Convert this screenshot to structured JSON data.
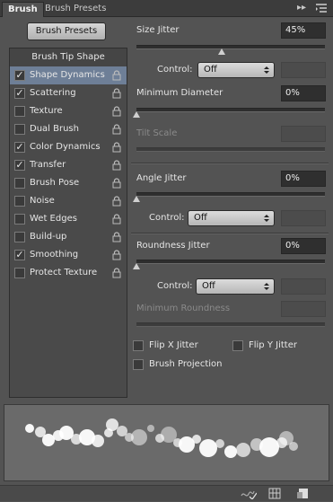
{
  "tabs": [
    {
      "label": "Brush",
      "active": true
    },
    {
      "label": "Brush Presets",
      "active": false
    }
  ],
  "panel_menu_icons": [
    "double-arrow-icon",
    "panel-menu-icon"
  ],
  "brush_presets_button": "Brush Presets",
  "left_list": {
    "header": "Brush Tip Shape",
    "items": [
      {
        "label": "Shape Dynamics",
        "checked": true,
        "selected": true,
        "locked": true
      },
      {
        "label": "Scattering",
        "checked": true,
        "selected": false,
        "locked": true
      },
      {
        "label": "Texture",
        "checked": false,
        "selected": false,
        "locked": true
      },
      {
        "label": "Dual Brush",
        "checked": false,
        "selected": false,
        "locked": true
      },
      {
        "label": "Color Dynamics",
        "checked": true,
        "selected": false,
        "locked": true
      },
      {
        "label": "Transfer",
        "checked": true,
        "selected": false,
        "locked": true
      },
      {
        "label": "Brush Pose",
        "checked": false,
        "selected": false,
        "locked": true
      },
      {
        "label": "Noise",
        "checked": false,
        "selected": false,
        "locked": true
      },
      {
        "label": "Wet Edges",
        "checked": false,
        "selected": false,
        "locked": true
      },
      {
        "label": "Build-up",
        "checked": false,
        "selected": false,
        "locked": true
      },
      {
        "label": "Smoothing",
        "checked": true,
        "selected": false,
        "locked": true
      },
      {
        "label": "Protect Texture",
        "checked": false,
        "selected": false,
        "locked": true
      }
    ]
  },
  "settings": {
    "size_jitter": {
      "label": "Size Jitter",
      "value": "45%",
      "slider": 0.45
    },
    "control1": {
      "label": "Control:",
      "value": "Off"
    },
    "minimum_diameter": {
      "label": "Minimum Diameter",
      "value": "0%",
      "slider": 0.0
    },
    "tilt_scale": {
      "label": "Tilt Scale",
      "value": "",
      "enabled": false
    },
    "angle_jitter": {
      "label": "Angle Jitter",
      "value": "0%",
      "slider": 0.0
    },
    "control2": {
      "label": "Control:",
      "value": "Off"
    },
    "roundness_jitter": {
      "label": "Roundness Jitter",
      "value": "0%",
      "slider": 0.0
    },
    "control3": {
      "label": "Control:",
      "value": "Off"
    },
    "minimum_roundness": {
      "label": "Minimum Roundness",
      "value": "",
      "enabled": false
    },
    "flip_x": {
      "label": "Flip X Jitter",
      "checked": false
    },
    "flip_y": {
      "label": "Flip Y Jitter",
      "checked": false
    },
    "brush_projection": {
      "label": "Brush Projection",
      "checked": false
    }
  },
  "status_icons": [
    "toggle-brush-preview-icon",
    "grid-icon",
    "new-brush-icon"
  ],
  "colors": {
    "panel_bg": "#535353",
    "selected_item": "#6e7f97",
    "tab_bar": "#3c3c3c"
  }
}
